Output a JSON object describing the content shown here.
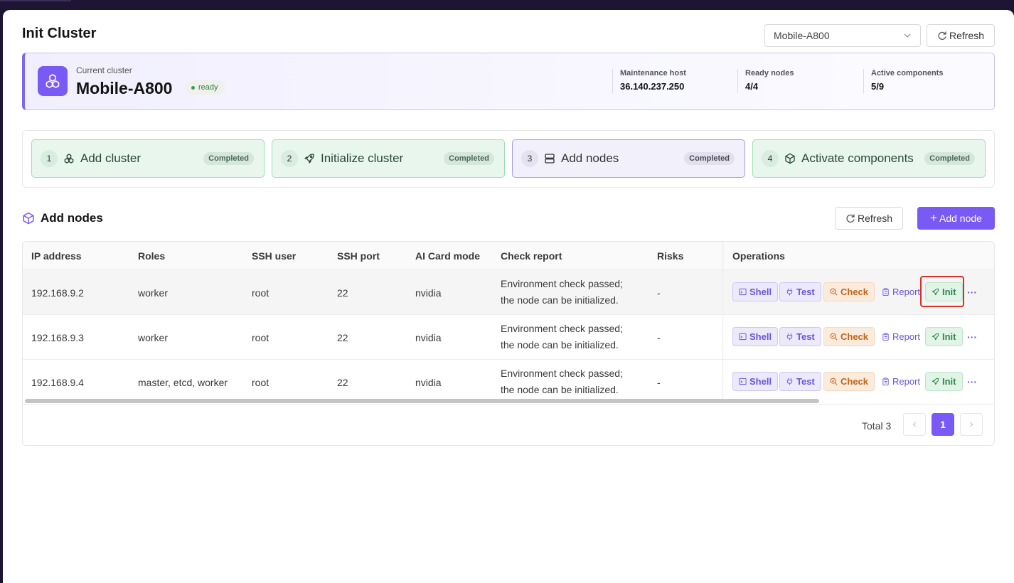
{
  "page": {
    "title": "Init Cluster"
  },
  "header": {
    "cluster_select": {
      "value": "Mobile-A800"
    },
    "refresh_label": "Refresh"
  },
  "cluster": {
    "caption": "Current cluster",
    "name": "Mobile-A800",
    "status": "ready",
    "stats": [
      {
        "label": "Maintenance host",
        "value": "36.140.237.250"
      },
      {
        "label": "Ready nodes",
        "value": "4/4"
      },
      {
        "label": "Active components",
        "value": "5/9"
      }
    ]
  },
  "steps": [
    {
      "num": "1",
      "label": "Add cluster",
      "status": "Completed",
      "icon": "cluster-icon"
    },
    {
      "num": "2",
      "label": "Initialize cluster",
      "status": "Completed",
      "icon": "rocket-icon"
    },
    {
      "num": "3",
      "label": "Add nodes",
      "status": "Completed",
      "icon": "server-icon"
    },
    {
      "num": "4",
      "label": "Activate components",
      "status": "Completed",
      "icon": "package-icon"
    }
  ],
  "section": {
    "title": "Add nodes",
    "refresh_label": "Refresh",
    "add_label": "Add node"
  },
  "table": {
    "headers": [
      "IP address",
      "Roles",
      "SSH user",
      "SSH port",
      "AI Card mode",
      "Check report",
      "Risks",
      "Operations"
    ],
    "rows": [
      {
        "ip": "192.168.9.2",
        "roles": "worker",
        "ssh_user": "root",
        "ssh_port": "22",
        "card_mode": "nvidia",
        "report_line1": "Environment check passed;",
        "report_line2": "the node can be initialized.",
        "risks": "-"
      },
      {
        "ip": "192.168.9.3",
        "roles": "worker",
        "ssh_user": "root",
        "ssh_port": "22",
        "card_mode": "nvidia",
        "report_line1": "Environment check passed;",
        "report_line2": "the node can be initialized.",
        "risks": "-"
      },
      {
        "ip": "192.168.9.4",
        "roles": "master, etcd, worker",
        "ssh_user": "root",
        "ssh_port": "22",
        "card_mode": "nvidia",
        "report_line1": "Environment check passed;",
        "report_line2": "the node can be initialized.",
        "risks": "-"
      }
    ],
    "ops": {
      "shell": "Shell",
      "test": "Test",
      "check": "Check",
      "report": "Report",
      "init": "Init",
      "more": "···"
    }
  },
  "pagination": {
    "total": "Total 3",
    "current": "1"
  },
  "colors": {
    "accent": "#7a5af5",
    "success": "#2e8a48",
    "warning": "#c0651a",
    "highlight": "#d93025"
  }
}
